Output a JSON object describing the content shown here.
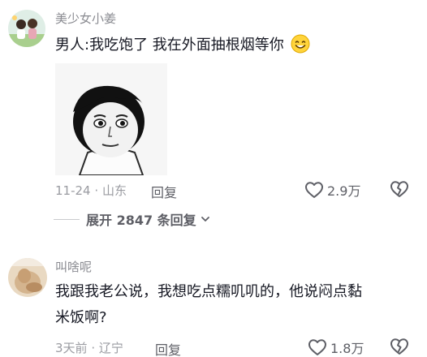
{
  "comments": [
    {
      "username": "美少女小姜",
      "text": "男人:我吃饱了 我在外面抽根烟等你",
      "emoji": "smile-emoji",
      "sticker": "meme-face-sticker",
      "date": "11-24",
      "location": "山东",
      "reply_label": "回复",
      "likes": "2.9万"
    },
    {
      "username": "叫啥呢",
      "text_line1": "我跟我老公说，我想吃点糯叽叽的，他说闷点黏",
      "text_line2": "米饭啊?",
      "date": "3天前",
      "location": "辽宁",
      "reply_label": "回复",
      "likes": "1.8万"
    }
  ],
  "expand": {
    "label": "展开 2847 条回复"
  },
  "separator": "·",
  "icons": {
    "like": "heart-outline-icon",
    "dislike": "broken-heart-icon",
    "chevron": "chevron-down-icon"
  },
  "colors": {
    "text": "#161823",
    "secondary": "#8a8b91",
    "meta": "#9a9ba1"
  }
}
